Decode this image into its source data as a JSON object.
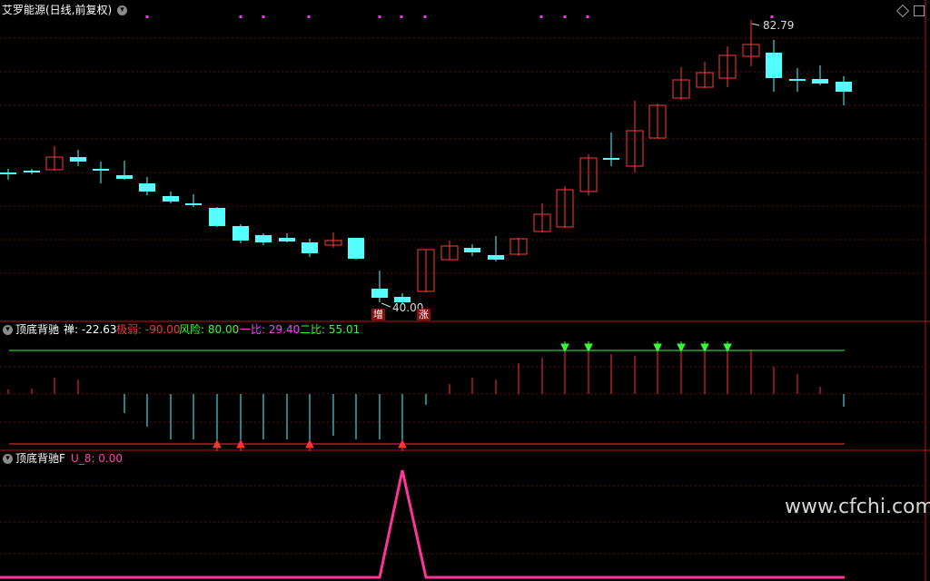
{
  "header": {
    "title": "艾罗能源(日线,前复权)",
    "menu_icon": "chevron-down-icon"
  },
  "main_chart": {
    "high_label": "82.79",
    "low_label": "40.00",
    "tag_left": "增",
    "tag_right": "涨",
    "candle_up_color": "#ff3b3b",
    "candle_down_color": "#54ffff"
  },
  "indicator1": {
    "name": "顶底背驰",
    "fields": [
      {
        "label": "禅:",
        "value": "-22.63",
        "color": "#ffffff"
      },
      {
        "label": "极弱:",
        "value": "-90.00",
        "color": "#ff3333"
      },
      {
        "label": "风险:",
        "value": "80.00",
        "color": "#33ff33"
      },
      {
        "label": "一比:",
        "value": "29.40",
        "color": "#ff44ff"
      },
      {
        "label": "二比:",
        "value": "55.01",
        "color": "#33ff33"
      }
    ]
  },
  "indicator2": {
    "name": "顶底背驰F",
    "field_label": "U_8:",
    "field_value": "0.00",
    "line_color": "#ff3399"
  },
  "watermark": "www.cfchi.com",
  "controls": {
    "diamond_icon": "diamond-icon",
    "maximize_icon": "maximize-icon"
  }
}
